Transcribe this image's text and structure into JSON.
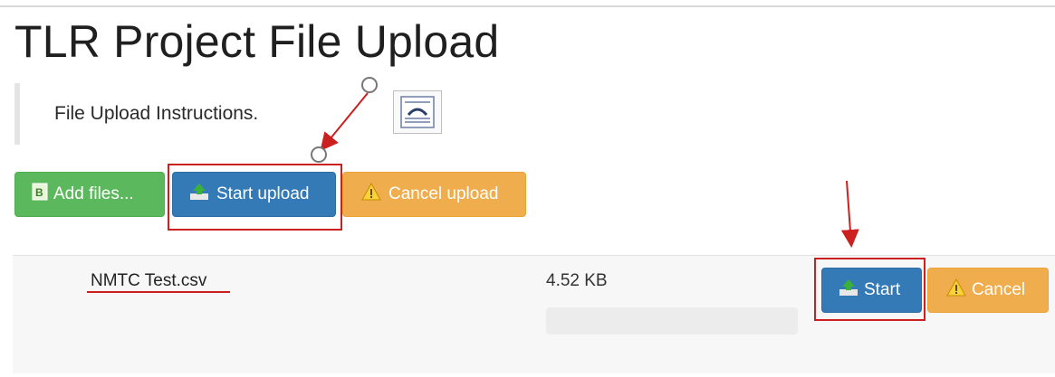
{
  "page": {
    "title": "TLR Project File Upload",
    "instructions": "File Upload Instructions."
  },
  "toolbar": {
    "add_label": "Add files...",
    "start_label": "Start upload",
    "cancel_label": "Cancel upload"
  },
  "files": [
    {
      "name": "NMTC Test.csv",
      "size": "4.52 KB",
      "progress": 0,
      "start_label": "Start",
      "cancel_label": "Cancel"
    }
  ],
  "colors": {
    "green": "#5cb85c",
    "blue": "#337ab7",
    "orange": "#f0ad4e",
    "annotation_red": "#cc1f1f"
  },
  "icons": {
    "add": "add-file-icon",
    "upload": "upload-icon",
    "warning": "warning-icon",
    "document": "document-icon"
  }
}
